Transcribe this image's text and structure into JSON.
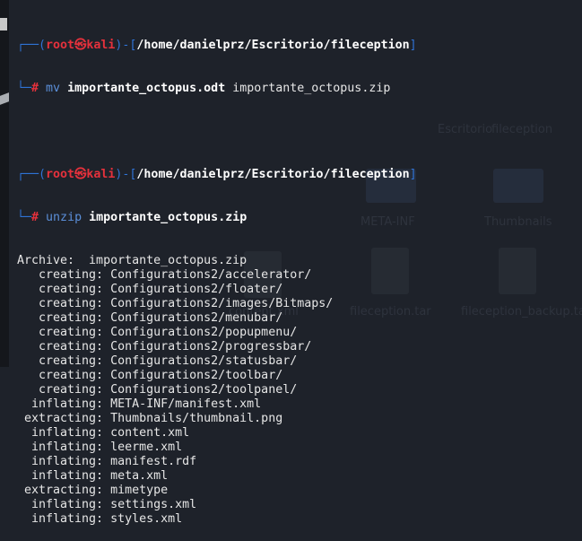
{
  "background": {
    "ghost_text": [
      "Escritorio",
      "fileception",
      "META-INF",
      "Thumbnails",
      "content.xml",
      "fileception.tar",
      "fileception_backup.tar"
    ]
  },
  "terminal": {
    "prompt_user": "root",
    "prompt_sep": "㉿",
    "prompt_host": "kali",
    "prompt_path": "/home/danielprz/Escritorio/fileception",
    "prompt_symbol": "#",
    "commands": [
      {
        "cmd": "mv",
        "arg1": "importante_octopus.odt",
        "arg2": "importante_octopus.zip"
      },
      {
        "cmd": "unzip",
        "arg1": "importante_octopus.zip"
      }
    ],
    "output": [
      "Archive:  importante_octopus.zip",
      "   creating: Configurations2/accelerator/",
      "   creating: Configurations2/floater/",
      "   creating: Configurations2/images/Bitmaps/",
      "   creating: Configurations2/menubar/",
      "   creating: Configurations2/popupmenu/",
      "   creating: Configurations2/progressbar/",
      "   creating: Configurations2/statusbar/",
      "   creating: Configurations2/toolbar/",
      "   creating: Configurations2/toolpanel/",
      "  inflating: META-INF/manifest.xml",
      " extracting: Thumbnails/thumbnail.png",
      "  inflating: content.xml",
      "  inflating: leerme.xml",
      "  inflating: manifest.rdf",
      "  inflating: meta.xml",
      " extracting: mimetype",
      "  inflating: settings.xml",
      "  inflating: styles.xml"
    ]
  }
}
